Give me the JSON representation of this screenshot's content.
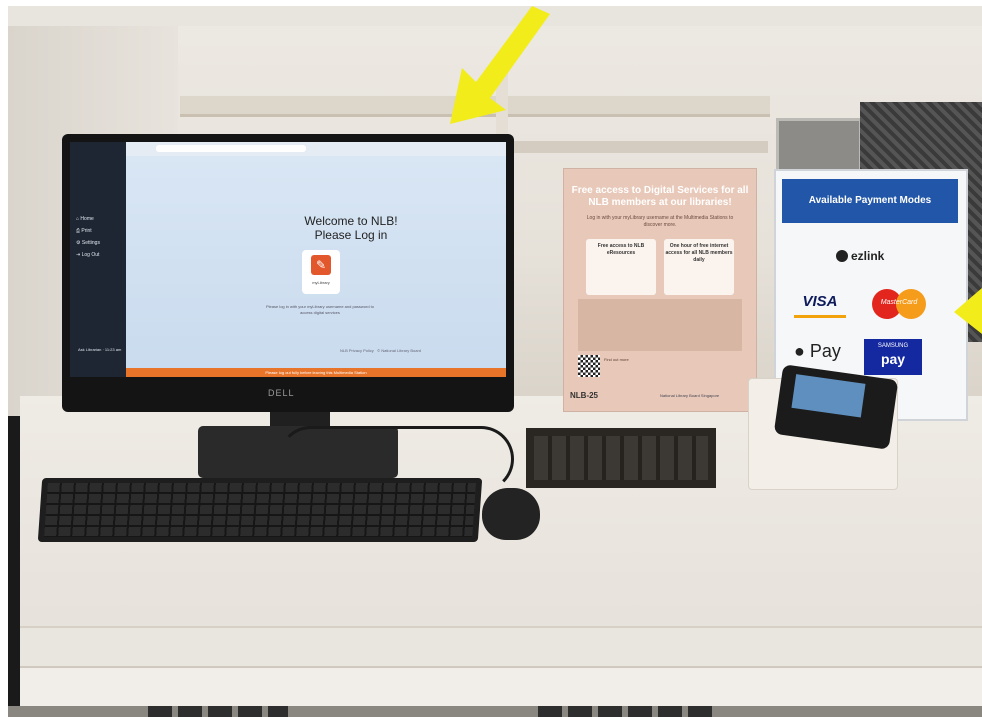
{
  "screen": {
    "sidebar_items": [
      "Home",
      "Print",
      "Settings",
      "Log Out"
    ],
    "sidebar_time": "Ask Librarian · 11:23 am",
    "welcome_line1": "Welcome to NLB!",
    "welcome_line2": "Please Log in",
    "app_label": "myLibrary",
    "login_hint": "Please log in with your myLibrary username and password to access digital services",
    "footer_left": "NLB Privacy Policy",
    "footer_right": "© National Library Board",
    "orange_banner": "Please log out fully before leaving this Multimedia Station"
  },
  "monitor": {
    "brand": "DELL"
  },
  "poster": {
    "title": "Free access to Digital Services for all NLB members at our libraries!",
    "subtitle": "Log in with your myLibrary username at the Multimedia Stations to discover more.",
    "box1": "Free access to NLB eResources",
    "box2": "One hour of free internet access for all NLB members daily",
    "qr_text": "Find out more",
    "logo": "NLB-25",
    "logo2": "National Library Board Singapore"
  },
  "payment_sign": {
    "title": "Available Payment Modes",
    "ezlink": "ezlink",
    "visa": "VISA",
    "mastercard": "MasterCard",
    "apple_pay": "Pay",
    "samsung_top": "SAMSUNG",
    "samsung_pay": "pay"
  },
  "colors": {
    "arrow": "#f2ec1a",
    "orange_bar": "#e8742a",
    "pay_title_bg": "#2256a8"
  }
}
